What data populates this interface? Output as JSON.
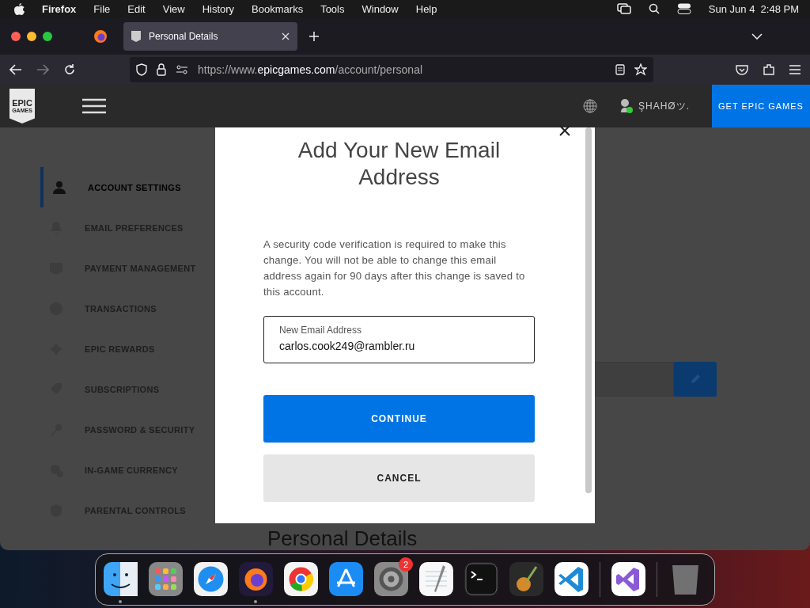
{
  "menu_bar": {
    "app": "Firefox",
    "items": [
      "File",
      "Edit",
      "View",
      "History",
      "Bookmarks",
      "Tools",
      "Window",
      "Help"
    ],
    "clock": "Sun Jun 4  2:48 PM"
  },
  "browser": {
    "tab": {
      "title": "Personal Details",
      "selected": true
    },
    "url": {
      "scheme": "https://www.",
      "host": "epicgames.com",
      "path": "/account/personal"
    }
  },
  "site_header": {
    "logo_top": "EPIC",
    "logo_bottom": "GAMES",
    "user": "ŞHAHØツ.",
    "cta": "GET EPIC GAMES"
  },
  "sidebar": {
    "items": [
      {
        "label": "ACCOUNT SETTINGS",
        "selected": true
      },
      {
        "label": "EMAIL PREFERENCES",
        "selected": false
      },
      {
        "label": "PAYMENT MANAGEMENT",
        "selected": false
      },
      {
        "label": "TRANSACTIONS",
        "selected": false
      },
      {
        "label": "EPIC REWARDS",
        "selected": false
      },
      {
        "label": "SUBSCRIPTIONS",
        "selected": false
      },
      {
        "label": "PASSWORD & SECURITY",
        "selected": false
      },
      {
        "label": "IN-GAME CURRENCY",
        "selected": false
      },
      {
        "label": "PARENTAL CONTROLS",
        "selected": false
      }
    ]
  },
  "page": {
    "heading": "Personal Details"
  },
  "dialog": {
    "title": "Add Your New Email Address",
    "message": "A security code verification is required to make this change. You will not be able to change this email address again for 90 days after this change is saved to this account.",
    "field": {
      "label": "New Email Address",
      "value": "carlos.cook249@rambler.ru"
    },
    "buttons": [
      {
        "label": "CONTINUE",
        "kind": "primary"
      },
      {
        "label": "CANCEL",
        "kind": "secondary"
      }
    ]
  },
  "dock": {
    "apps": [
      {
        "kind": "finder",
        "running": true
      },
      {
        "kind": "launchpad",
        "running": false
      },
      {
        "kind": "safari",
        "running": false
      },
      {
        "kind": "firefox",
        "running": true
      },
      {
        "kind": "chrome",
        "running": false
      },
      {
        "kind": "appstore",
        "running": false
      },
      {
        "kind": "settings",
        "running": false,
        "badge": "2"
      },
      {
        "kind": "textedit",
        "running": false
      },
      {
        "kind": "terminal",
        "running": false
      },
      {
        "kind": "garageband",
        "running": false
      },
      {
        "kind": "vscode",
        "running": false
      },
      {
        "kind": "visualstudio",
        "running": false
      },
      {
        "kind": "trash",
        "running": false
      }
    ]
  }
}
